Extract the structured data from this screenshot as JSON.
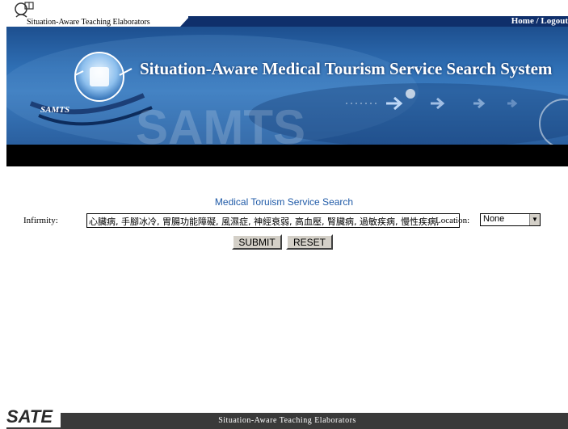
{
  "header": {
    "org_label": "Situation-Aware Teaching Elaborators",
    "nav": "Home / Logout"
  },
  "banner": {
    "title": "Situation-Aware Medical Tourism Service Search System",
    "logo_text": "SAMTS"
  },
  "search": {
    "title": "Medical Toruism Service Search",
    "infirmity_label": "Infirmity:",
    "infirmity_value": "心臟病, 手腳冰冷, 胃腸功能障礙, 風濕症, 神經衰弱, 高血壓, 腎臟病, 過敏疾病, 慢性疾病,",
    "location_label": "Location:",
    "location_value": "None",
    "submit_label": "SUBMIT",
    "reset_label": "RESET"
  },
  "footer": {
    "logo": "SATE",
    "text": "Situation-Aware Teaching Elaborators"
  }
}
